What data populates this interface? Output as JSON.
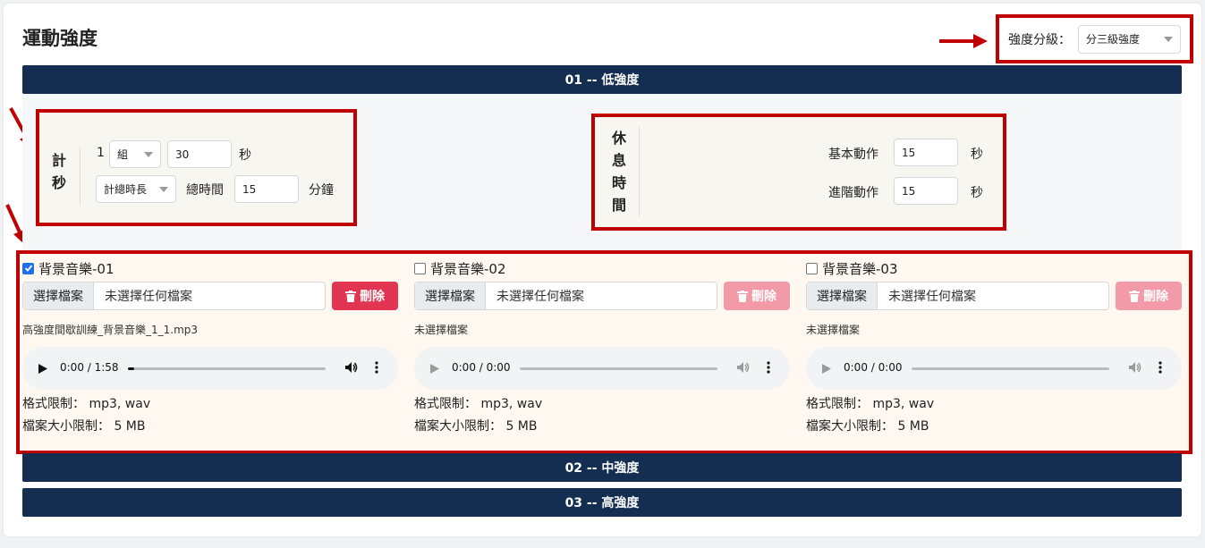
{
  "page_title": "運動強度",
  "level": {
    "label": "強度分級：",
    "selected": "分三級強度"
  },
  "bars": {
    "low": "01 -- 低強度",
    "mid": "02 -- 中強度",
    "high": "03 -- 高強度"
  },
  "timer": {
    "label_chars": [
      "計",
      "秒"
    ],
    "sets_count": "1",
    "sets_unit": "組",
    "seconds_value": "30",
    "seconds_unit": "秒",
    "mode": "計總時長",
    "total_label": "總時間",
    "total_value": "15",
    "total_unit": "分鐘"
  },
  "rest": {
    "label_chars": [
      "休",
      "息",
      "時",
      "間"
    ],
    "basic_label": "基本動作",
    "basic_value": "15",
    "basic_unit": "秒",
    "advanced_label": "進階動作",
    "advanced_value": "15",
    "advanced_unit": "秒"
  },
  "music": [
    {
      "name": "背景音樂-01",
      "checked": true,
      "choose_label": "選擇檔案",
      "file_status": "未選擇任何檔案",
      "delete_label": "刪除",
      "filename": "高強度間歇訓練_背景音樂_1_1.mp3",
      "time": "0:00 / 1:58",
      "format_label": "格式限制：",
      "format_value": "mp3, wav",
      "size_label": "檔案大小限制：",
      "size_value": "5 MB"
    },
    {
      "name": "背景音樂-02",
      "checked": false,
      "choose_label": "選擇檔案",
      "file_status": "未選擇任何檔案",
      "delete_label": "刪除",
      "filename": "未選擇檔案",
      "time": "0:00 / 0:00",
      "format_label": "格式限制：",
      "format_value": "mp3, wav",
      "size_label": "檔案大小限制：",
      "size_value": "5 MB"
    },
    {
      "name": "背景音樂-03",
      "checked": false,
      "choose_label": "選擇檔案",
      "file_status": "未選擇任何檔案",
      "delete_label": "刪除",
      "filename": "未選擇檔案",
      "time": "0:00 / 0:00",
      "format_label": "格式限制：",
      "format_value": "mp3, wav",
      "size_label": "檔案大小限制：",
      "size_value": "5 MB"
    }
  ],
  "colors": {
    "accent_bar": "#142e52",
    "annotation_red": "#c00000",
    "delete_red": "#e23552"
  }
}
